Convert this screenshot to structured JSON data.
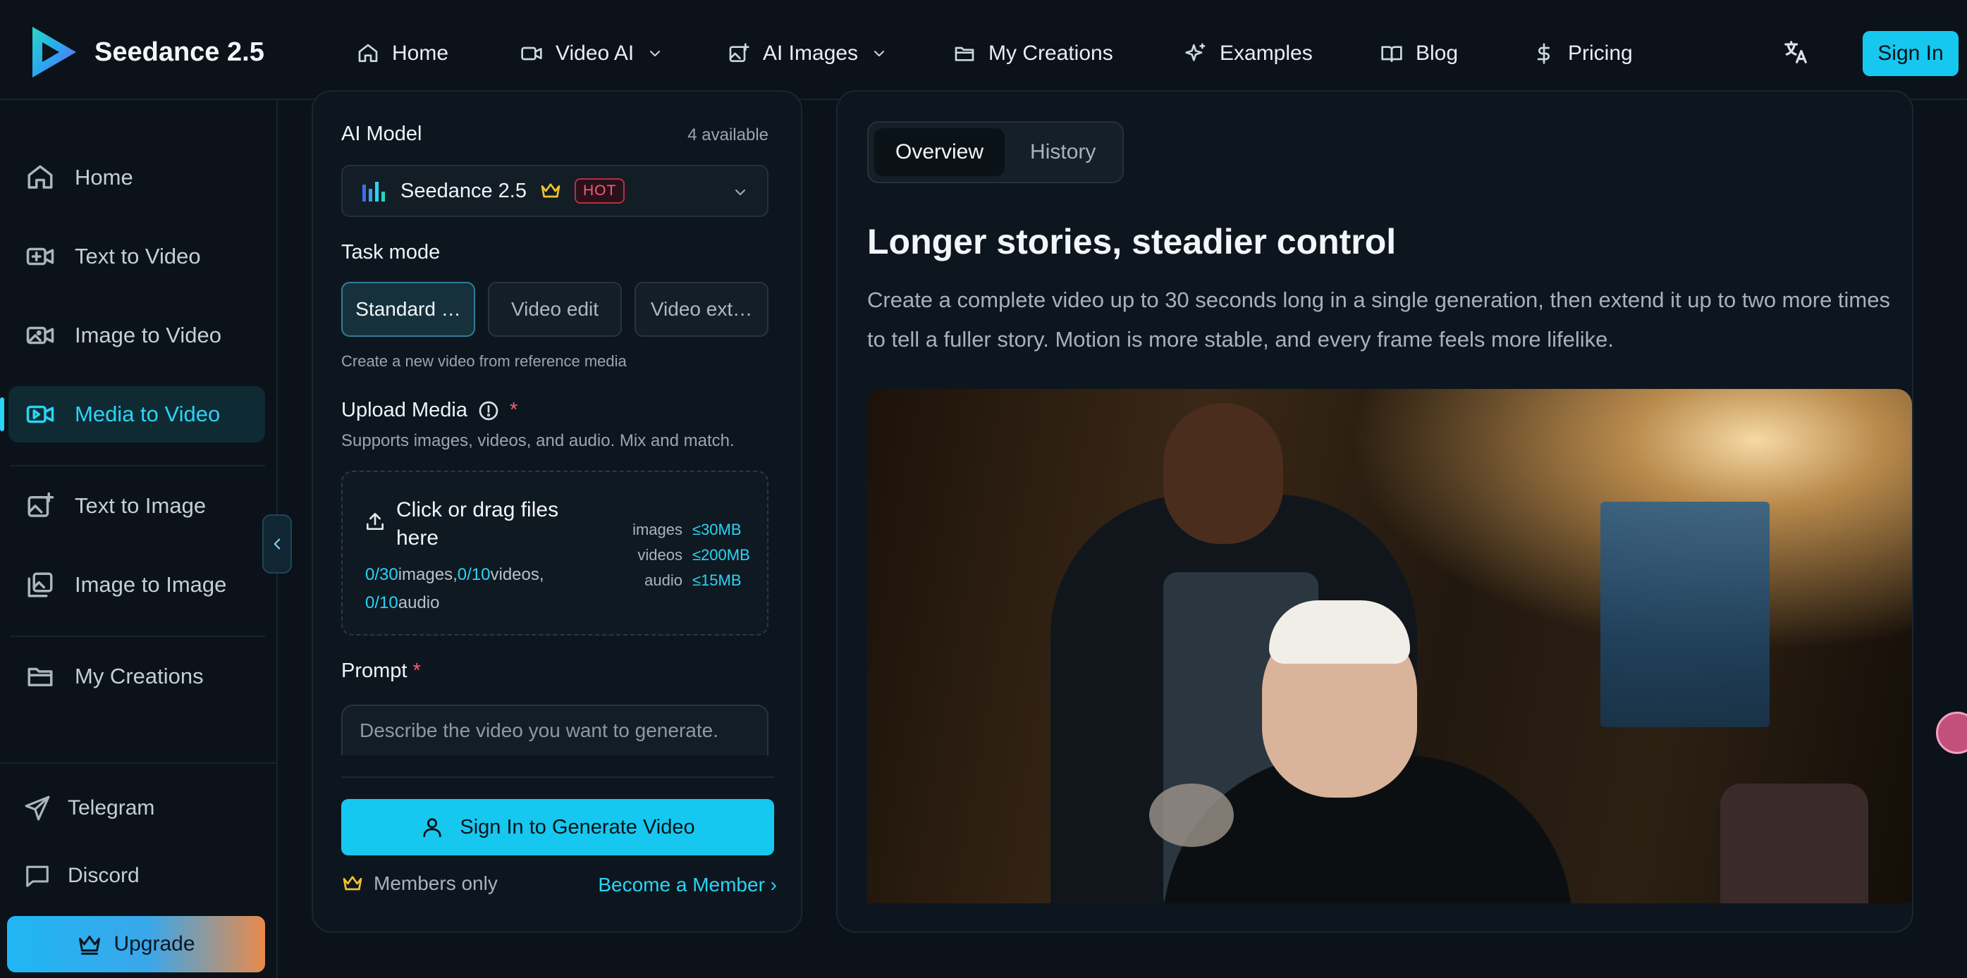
{
  "brand": {
    "name": "Seedance 2.5"
  },
  "topnav": {
    "items": [
      {
        "label": "Home",
        "icon": "home-icon"
      },
      {
        "label": "Video AI",
        "icon": "video-camera-icon",
        "dropdown": true
      },
      {
        "label": "AI Images",
        "icon": "image-plus-icon",
        "dropdown": true
      },
      {
        "label": "My Creations",
        "icon": "folder-icon"
      },
      {
        "label": "Examples",
        "icon": "sparkles-icon"
      },
      {
        "label": "Blog",
        "icon": "book-icon"
      },
      {
        "label": "Pricing",
        "icon": "dollar-icon"
      }
    ],
    "language_icon": "translate-icon",
    "sign_in": "Sign In"
  },
  "sidebar": {
    "items": [
      {
        "label": "Home",
        "icon": "home-icon"
      },
      {
        "label": "Text to Video",
        "icon": "video-plus-icon"
      },
      {
        "label": "Image to Video",
        "icon": "image-video-icon"
      },
      {
        "label": "Media to Video",
        "icon": "media-video-icon",
        "active": true
      },
      {
        "label": "Text to Image",
        "icon": "image-plus-icon"
      },
      {
        "label": "Image to Image",
        "icon": "images-icon"
      },
      {
        "label": "My Creations",
        "icon": "folder-icon"
      }
    ],
    "links": [
      {
        "label": "Telegram",
        "icon": "send-icon"
      },
      {
        "label": "Discord",
        "icon": "chat-icon"
      }
    ],
    "upgrade": "Upgrade"
  },
  "form": {
    "model_label": "AI Model",
    "model_available": "4 available",
    "model_name": "Seedance 2.5",
    "model_badge": "HOT",
    "task_label": "Task mode",
    "tasks": [
      "Standard …",
      "Video edit",
      "Video ext…"
    ],
    "task_hint": "Create a new video from reference media",
    "upload_label": "Upload Media",
    "upload_required": "*",
    "upload_hint": "Supports images, videos, and audio. Mix and match.",
    "upload_title": "Click or drag files here",
    "counts": {
      "images_val": "0/30",
      "images_lbl": "images,",
      "videos_val": "0/10",
      "videos_lbl": "videos,",
      "audio_val": "0/10",
      "audio_lbl": "audio"
    },
    "limits": [
      {
        "type": "images",
        "max": "≤30MB"
      },
      {
        "type": "videos",
        "max": "≤200MB"
      },
      {
        "type": "audio",
        "max": "≤15MB"
      }
    ],
    "prompt_label": "Prompt",
    "prompt_required": "*",
    "prompt_placeholder": "Describe the video you want to generate.",
    "generate_button": "Sign In to Generate Video",
    "members_only": "Members only",
    "become_member": "Become a Member ›"
  },
  "overview": {
    "tabs": [
      {
        "label": "Overview",
        "active": true
      },
      {
        "label": "History"
      }
    ],
    "title": "Longer stories, steadier control",
    "description": "Create a complete video up to 30 seconds long in a single generation, then extend it up to two more times to tell a fuller story. Motion is more stable, and every frame feels more lifelike."
  },
  "colors": {
    "accent": "#16c8ef",
    "background": "#0b1219",
    "hot": "#f0607b",
    "crown": "#f2c230"
  }
}
